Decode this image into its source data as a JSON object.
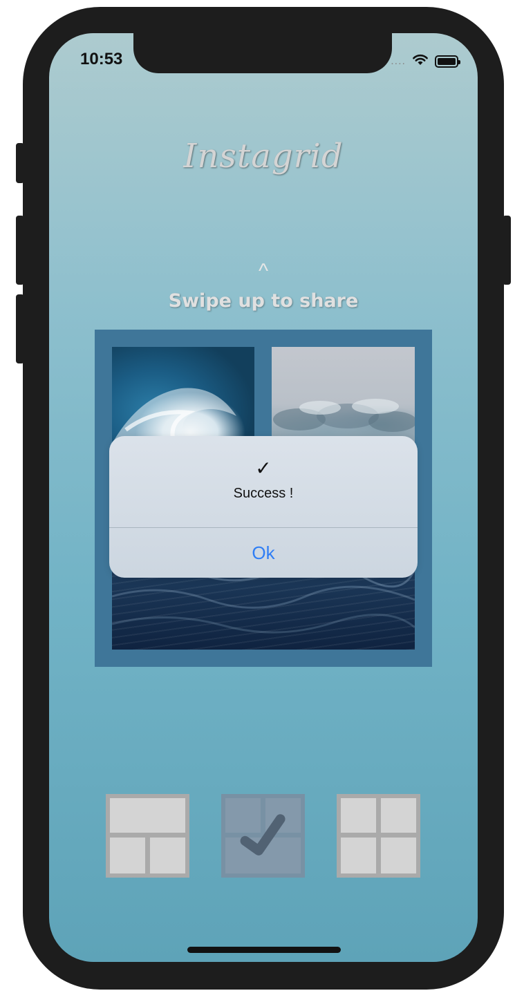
{
  "status_bar": {
    "time": "10:53",
    "signal": "....",
    "icons": [
      "wifi-icon",
      "battery-icon"
    ]
  },
  "app": {
    "title": "Instagrid"
  },
  "swipe": {
    "chevron": "^",
    "label": "Swipe up to share"
  },
  "photos": [
    {
      "name": "wave"
    },
    {
      "name": "clouds"
    },
    {
      "name": "sea"
    }
  ],
  "alert": {
    "icon": "✓",
    "message": "Success !",
    "button_label": "Ok"
  },
  "layouts": [
    {
      "name": "layout-one-top-two-bottom",
      "selected": false
    },
    {
      "name": "layout-two-top-one-bottom",
      "selected": true
    },
    {
      "name": "layout-four-squares",
      "selected": false
    }
  ],
  "colors": {
    "frame": "#3f7699",
    "alert_button": "#2f7ef5",
    "layout_button": "#aaaaaa",
    "layout_selected": "#7891a4"
  }
}
